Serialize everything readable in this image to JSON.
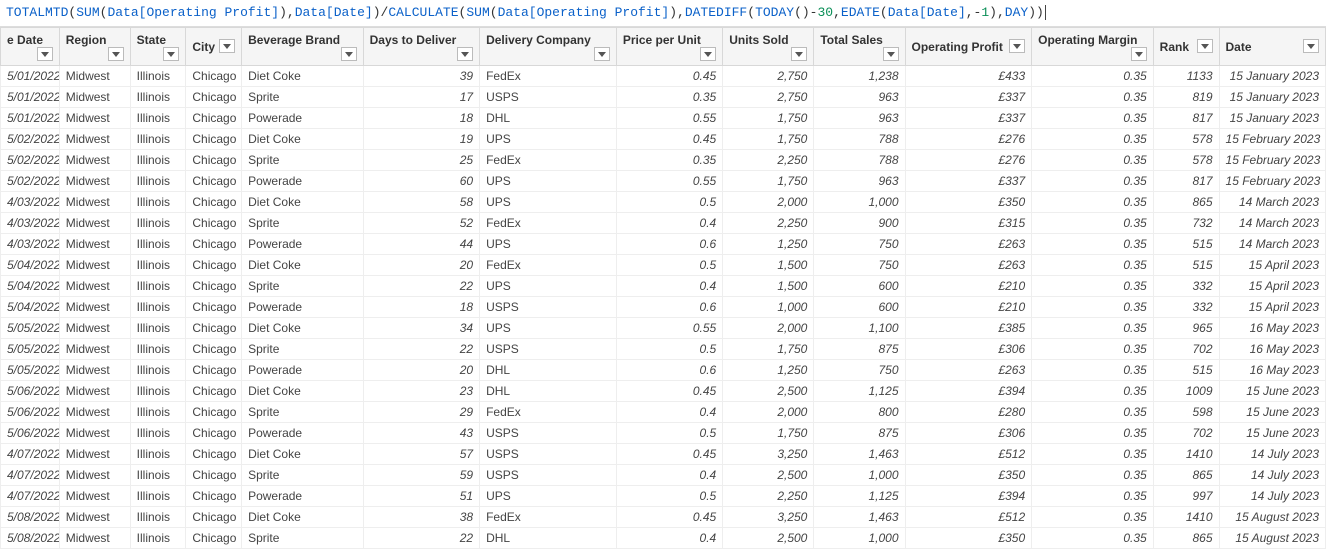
{
  "formula_html": "<span class='fn'>TOTALMTD</span><span class='punc'>(</span><span class='fn'>SUM</span><span class='punc'>(</span><span class='ident'>Data[Operating Profit]</span><span class='punc'>),</span><span class='ident'>Data[Date]</span><span class='punc'>)/</span><span class='fn'>CALCULATE</span><span class='punc'>(</span><span class='fn'>SUM</span><span class='punc'>(</span><span class='ident'>Data[Operating Profit]</span><span class='punc'>),</span><span class='fn'>DATEDIFF</span><span class='punc'>(</span><span class='fn'>TODAY</span><span class='punc'>()-</span><span class='num'>30</span><span class='punc'>,</span><span class='fn'>EDATE</span><span class='punc'>(</span><span class='ident'>Data[Date]</span><span class='punc'>,-</span><span class='num'>1</span><span class='punc'>),</span><span class='ident'>DAY</span><span class='punc'>)</span><span class='punc cursor'>)</span>",
  "columns": [
    {
      "key": "inv_date",
      "label": "e Date",
      "align": "i",
      "col": "c-invdate"
    },
    {
      "key": "region",
      "label": "Region",
      "align": "",
      "col": "c-region"
    },
    {
      "key": "state",
      "label": "State",
      "align": "",
      "col": "c-state"
    },
    {
      "key": "city",
      "label": "City",
      "align": "",
      "col": "c-city"
    },
    {
      "key": "brand",
      "label": "Beverage Brand",
      "align": "",
      "col": "c-brand"
    },
    {
      "key": "days",
      "label": "Days to Deliver",
      "align": "r",
      "col": "c-days"
    },
    {
      "key": "deliv",
      "label": "Delivery Company",
      "align": "",
      "col": "c-deliv"
    },
    {
      "key": "price",
      "label": "Price per Unit",
      "align": "r",
      "col": "c-price"
    },
    {
      "key": "units",
      "label": "Units Sold",
      "align": "r",
      "col": "c-units"
    },
    {
      "key": "sales",
      "label": "Total Sales",
      "align": "r",
      "col": "c-sales"
    },
    {
      "key": "profit",
      "label": "Operating Profit",
      "align": "r",
      "col": "c-profit"
    },
    {
      "key": "margin",
      "label": "Operating Margin",
      "align": "r",
      "col": "c-margin"
    },
    {
      "key": "rank",
      "label": "Rank",
      "align": "r",
      "col": "c-rank"
    },
    {
      "key": "date",
      "label": "Date",
      "align": "r",
      "col": "c-date"
    }
  ],
  "rows": [
    {
      "inv_date": "5/01/2022",
      "region": "Midwest",
      "state": "Illinois",
      "city": "Chicago",
      "brand": "Diet Coke",
      "days": "39",
      "deliv": "FedEx",
      "price": "0.45",
      "units": "2,750",
      "sales": "1,238",
      "profit": "£433",
      "margin": "0.35",
      "rank": "1133",
      "date": "15 January 2023"
    },
    {
      "inv_date": "5/01/2022",
      "region": "Midwest",
      "state": "Illinois",
      "city": "Chicago",
      "brand": "Sprite",
      "days": "17",
      "deliv": "USPS",
      "price": "0.35",
      "units": "2,750",
      "sales": "963",
      "profit": "£337",
      "margin": "0.35",
      "rank": "819",
      "date": "15 January 2023"
    },
    {
      "inv_date": "5/01/2022",
      "region": "Midwest",
      "state": "Illinois",
      "city": "Chicago",
      "brand": "Powerade",
      "days": "18",
      "deliv": "DHL",
      "price": "0.55",
      "units": "1,750",
      "sales": "963",
      "profit": "£337",
      "margin": "0.35",
      "rank": "817",
      "date": "15 January 2023"
    },
    {
      "inv_date": "5/02/2022",
      "region": "Midwest",
      "state": "Illinois",
      "city": "Chicago",
      "brand": "Diet Coke",
      "days": "19",
      "deliv": "UPS",
      "price": "0.45",
      "units": "1,750",
      "sales": "788",
      "profit": "£276",
      "margin": "0.35",
      "rank": "578",
      "date": "15 February 2023"
    },
    {
      "inv_date": "5/02/2022",
      "region": "Midwest",
      "state": "Illinois",
      "city": "Chicago",
      "brand": "Sprite",
      "days": "25",
      "deliv": "FedEx",
      "price": "0.35",
      "units": "2,250",
      "sales": "788",
      "profit": "£276",
      "margin": "0.35",
      "rank": "578",
      "date": "15 February 2023"
    },
    {
      "inv_date": "5/02/2022",
      "region": "Midwest",
      "state": "Illinois",
      "city": "Chicago",
      "brand": "Powerade",
      "days": "60",
      "deliv": "UPS",
      "price": "0.55",
      "units": "1,750",
      "sales": "963",
      "profit": "£337",
      "margin": "0.35",
      "rank": "817",
      "date": "15 February 2023"
    },
    {
      "inv_date": "4/03/2022",
      "region": "Midwest",
      "state": "Illinois",
      "city": "Chicago",
      "brand": "Diet Coke",
      "days": "58",
      "deliv": "UPS",
      "price": "0.5",
      "units": "2,000",
      "sales": "1,000",
      "profit": "£350",
      "margin": "0.35",
      "rank": "865",
      "date": "14 March 2023"
    },
    {
      "inv_date": "4/03/2022",
      "region": "Midwest",
      "state": "Illinois",
      "city": "Chicago",
      "brand": "Sprite",
      "days": "52",
      "deliv": "FedEx",
      "price": "0.4",
      "units": "2,250",
      "sales": "900",
      "profit": "£315",
      "margin": "0.35",
      "rank": "732",
      "date": "14 March 2023"
    },
    {
      "inv_date": "4/03/2022",
      "region": "Midwest",
      "state": "Illinois",
      "city": "Chicago",
      "brand": "Powerade",
      "days": "44",
      "deliv": "UPS",
      "price": "0.6",
      "units": "1,250",
      "sales": "750",
      "profit": "£263",
      "margin": "0.35",
      "rank": "515",
      "date": "14 March 2023"
    },
    {
      "inv_date": "5/04/2022",
      "region": "Midwest",
      "state": "Illinois",
      "city": "Chicago",
      "brand": "Diet Coke",
      "days": "20",
      "deliv": "FedEx",
      "price": "0.5",
      "units": "1,500",
      "sales": "750",
      "profit": "£263",
      "margin": "0.35",
      "rank": "515",
      "date": "15 April 2023"
    },
    {
      "inv_date": "5/04/2022",
      "region": "Midwest",
      "state": "Illinois",
      "city": "Chicago",
      "brand": "Sprite",
      "days": "22",
      "deliv": "UPS",
      "price": "0.4",
      "units": "1,500",
      "sales": "600",
      "profit": "£210",
      "margin": "0.35",
      "rank": "332",
      "date": "15 April 2023"
    },
    {
      "inv_date": "5/04/2022",
      "region": "Midwest",
      "state": "Illinois",
      "city": "Chicago",
      "brand": "Powerade",
      "days": "18",
      "deliv": "USPS",
      "price": "0.6",
      "units": "1,000",
      "sales": "600",
      "profit": "£210",
      "margin": "0.35",
      "rank": "332",
      "date": "15 April 2023"
    },
    {
      "inv_date": "5/05/2022",
      "region": "Midwest",
      "state": "Illinois",
      "city": "Chicago",
      "brand": "Diet Coke",
      "days": "34",
      "deliv": "UPS",
      "price": "0.55",
      "units": "2,000",
      "sales": "1,100",
      "profit": "£385",
      "margin": "0.35",
      "rank": "965",
      "date": "16 May 2023"
    },
    {
      "inv_date": "5/05/2022",
      "region": "Midwest",
      "state": "Illinois",
      "city": "Chicago",
      "brand": "Sprite",
      "days": "22",
      "deliv": "USPS",
      "price": "0.5",
      "units": "1,750",
      "sales": "875",
      "profit": "£306",
      "margin": "0.35",
      "rank": "702",
      "date": "16 May 2023"
    },
    {
      "inv_date": "5/05/2022",
      "region": "Midwest",
      "state": "Illinois",
      "city": "Chicago",
      "brand": "Powerade",
      "days": "20",
      "deliv": "DHL",
      "price": "0.6",
      "units": "1,250",
      "sales": "750",
      "profit": "£263",
      "margin": "0.35",
      "rank": "515",
      "date": "16 May 2023"
    },
    {
      "inv_date": "5/06/2022",
      "region": "Midwest",
      "state": "Illinois",
      "city": "Chicago",
      "brand": "Diet Coke",
      "days": "23",
      "deliv": "DHL",
      "price": "0.45",
      "units": "2,500",
      "sales": "1,125",
      "profit": "£394",
      "margin": "0.35",
      "rank": "1009",
      "date": "15 June 2023"
    },
    {
      "inv_date": "5/06/2022",
      "region": "Midwest",
      "state": "Illinois",
      "city": "Chicago",
      "brand": "Sprite",
      "days": "29",
      "deliv": "FedEx",
      "price": "0.4",
      "units": "2,000",
      "sales": "800",
      "profit": "£280",
      "margin": "0.35",
      "rank": "598",
      "date": "15 June 2023"
    },
    {
      "inv_date": "5/06/2022",
      "region": "Midwest",
      "state": "Illinois",
      "city": "Chicago",
      "brand": "Powerade",
      "days": "43",
      "deliv": "USPS",
      "price": "0.5",
      "units": "1,750",
      "sales": "875",
      "profit": "£306",
      "margin": "0.35",
      "rank": "702",
      "date": "15 June 2023"
    },
    {
      "inv_date": "4/07/2022",
      "region": "Midwest",
      "state": "Illinois",
      "city": "Chicago",
      "brand": "Diet Coke",
      "days": "57",
      "deliv": "USPS",
      "price": "0.45",
      "units": "3,250",
      "sales": "1,463",
      "profit": "£512",
      "margin": "0.35",
      "rank": "1410",
      "date": "14 July 2023"
    },
    {
      "inv_date": "4/07/2022",
      "region": "Midwest",
      "state": "Illinois",
      "city": "Chicago",
      "brand": "Sprite",
      "days": "59",
      "deliv": "USPS",
      "price": "0.4",
      "units": "2,500",
      "sales": "1,000",
      "profit": "£350",
      "margin": "0.35",
      "rank": "865",
      "date": "14 July 2023"
    },
    {
      "inv_date": "4/07/2022",
      "region": "Midwest",
      "state": "Illinois",
      "city": "Chicago",
      "brand": "Powerade",
      "days": "51",
      "deliv": "UPS",
      "price": "0.5",
      "units": "2,250",
      "sales": "1,125",
      "profit": "£394",
      "margin": "0.35",
      "rank": "997",
      "date": "14 July 2023"
    },
    {
      "inv_date": "5/08/2022",
      "region": "Midwest",
      "state": "Illinois",
      "city": "Chicago",
      "brand": "Diet Coke",
      "days": "38",
      "deliv": "FedEx",
      "price": "0.45",
      "units": "3,250",
      "sales": "1,463",
      "profit": "£512",
      "margin": "0.35",
      "rank": "1410",
      "date": "15 August 2023"
    },
    {
      "inv_date": "5/08/2022",
      "region": "Midwest",
      "state": "Illinois",
      "city": "Chicago",
      "brand": "Sprite",
      "days": "22",
      "deliv": "DHL",
      "price": "0.4",
      "units": "2,500",
      "sales": "1,000",
      "profit": "£350",
      "margin": "0.35",
      "rank": "865",
      "date": "15 August 2023"
    }
  ]
}
